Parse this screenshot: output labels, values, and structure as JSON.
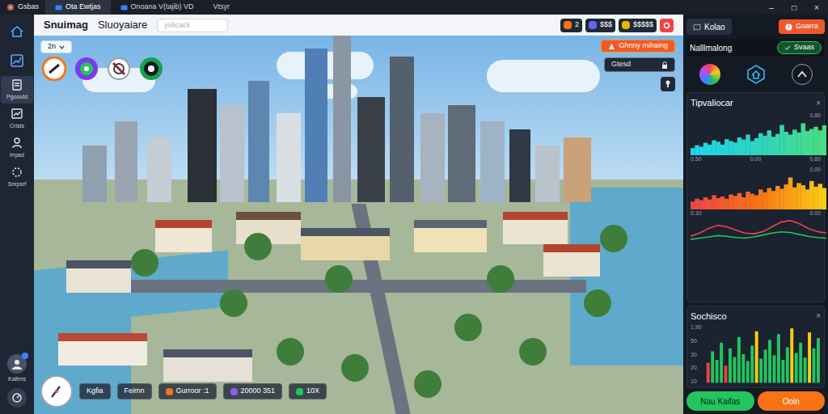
{
  "window": {
    "logo": "Gsbas",
    "tabs": [
      {
        "label": "Ota Ewtjas",
        "selected": true
      },
      {
        "label": "Onoana V(tajib) VD",
        "selected": false
      },
      {
        "label": "Vtsyr",
        "selected": false
      }
    ],
    "controls": [
      "–",
      "□",
      "×"
    ]
  },
  "header": {
    "title": "Snuimag",
    "subtitle": "Sluoyaiare",
    "search": {
      "placeholder": "yolicack"
    },
    "resources": [
      "2",
      "$$$",
      "$$$$$"
    ]
  },
  "sidebar": {
    "items": [
      {
        "selected": false
      },
      {
        "selected": false
      },
      {
        "label": "Pgooutd",
        "selected": true
      },
      {
        "label": "Crists",
        "selected": false
      },
      {
        "label": "Irrpsd",
        "selected": false
      },
      {
        "label": "Snrpsrf",
        "selected": false
      }
    ],
    "user": {
      "label": "Kaltrns",
      "notification": true
    }
  },
  "overlay": {
    "level": "2n",
    "alert": "Ghnny mihaing",
    "field": "Gtesd"
  },
  "bottom_bar": {
    "items": [
      "Kgfia",
      "Feimn",
      "Gurroor :1",
      "20000 351",
      "10X"
    ]
  },
  "panel": {
    "tab": "Kolao",
    "action": "Goarra",
    "subtitle": "Nalllmalong",
    "status": "Svaas",
    "trend_card": {
      "title": "Tipvaliocar",
      "close": "×",
      "area1": {
        "top": "0,80",
        "labels": [
          "0.50",
          "0.00",
          "0,60"
        ],
        "values": [
          20,
          28,
          24,
          35,
          30,
          42,
          38,
          30,
          45,
          40,
          36,
          50,
          44,
          58,
          40,
          48,
          62,
          55,
          70,
          52,
          60,
          85,
          66,
          58,
          72,
          64,
          90,
          68,
          74,
          80,
          70,
          84
        ]
      },
      "area2": {
        "top": "0,00",
        "labels": [
          "0.30",
          "0.00"
        ],
        "values": [
          22,
          30,
          26,
          34,
          28,
          40,
          32,
          36,
          30,
          42,
          38,
          46,
          34,
          50,
          44,
          40,
          56,
          48,
          60,
          52,
          66,
          58,
          70,
          90,
          62,
          74,
          68,
          56,
          80,
          64,
          72,
          60
        ]
      },
      "lines": [
        {
          "color": "#ef4444",
          "values": [
            20,
            30,
            45,
            55,
            50,
            40,
            30,
            28,
            35,
            50,
            65,
            70,
            60,
            45,
            35,
            30
          ]
        },
        {
          "color": "#22c55e",
          "values": [
            10,
            14,
            18,
            22,
            20,
            16,
            14,
            18,
            24,
            30,
            34,
            32,
            26,
            20,
            16,
            14
          ]
        }
      ]
    },
    "bar_card": {
      "title": "Sochisco",
      "close": "×",
      "ticks": [
        "1,90",
        "50",
        "30",
        "20",
        "10"
      ],
      "values": [
        35,
        55,
        40,
        70,
        30,
        60,
        45,
        80,
        50,
        38,
        65,
        90,
        42,
        58,
        75,
        48,
        85,
        40,
        62,
        95,
        52,
        70,
        44,
        88,
        60,
        78
      ]
    },
    "buttons": [
      "Nau Kaifas",
      "Ooin"
    ]
  }
}
